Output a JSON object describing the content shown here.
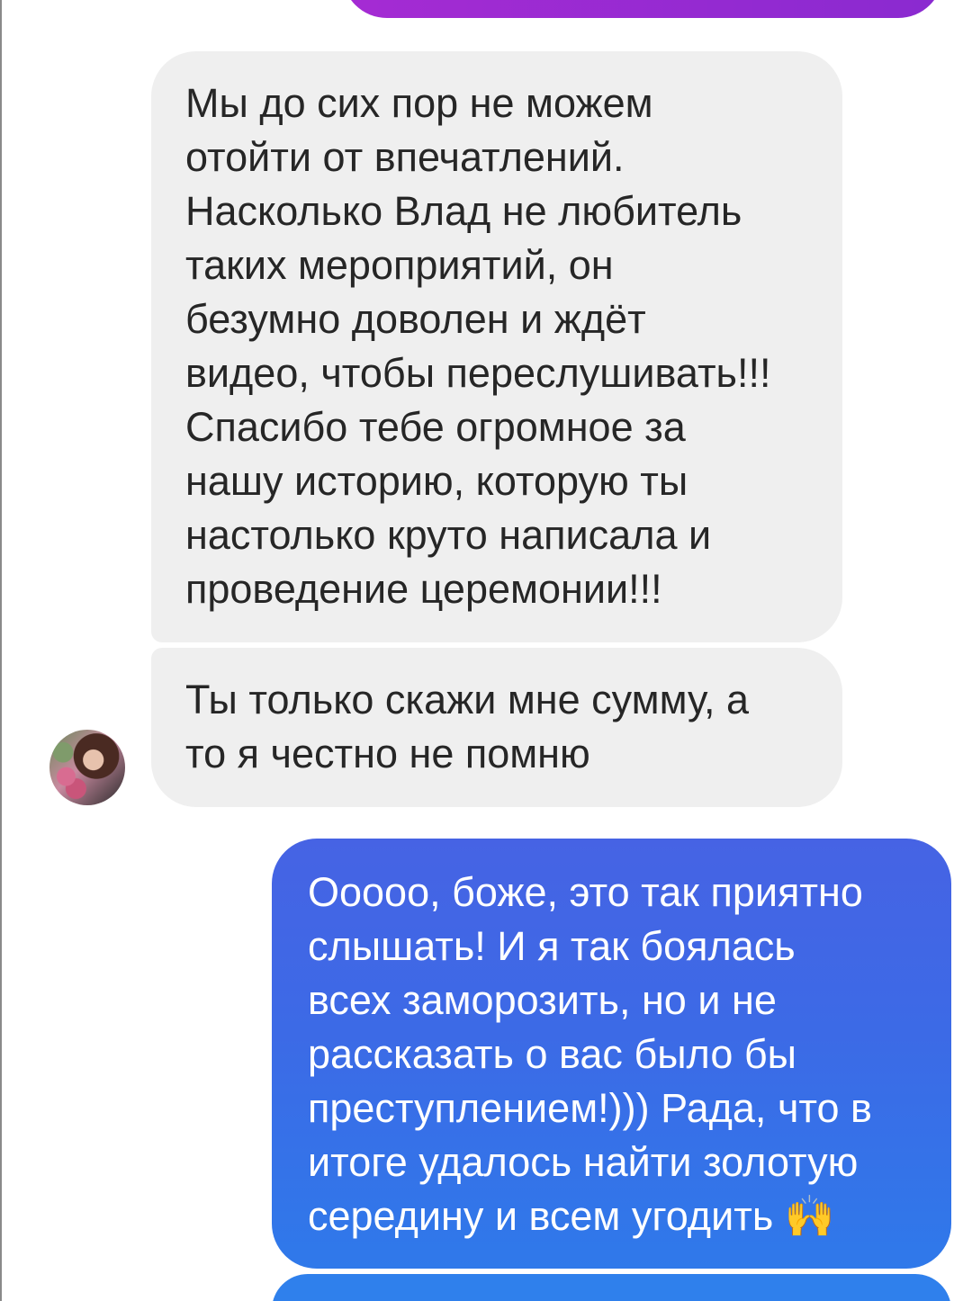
{
  "colors": {
    "incoming_bubble": "#efefef",
    "incoming_text": "#262626",
    "outgoing_top": "#4663e4",
    "outgoing_bottom": "#2f79ea",
    "previous_sent_bubble": "#9a2bd2"
  },
  "messages": [
    {
      "sender": "other",
      "text": "Мы до сих пор не можем\nотойти от впечатлений.\nНасколько Влад не любитель\nтаких мероприятий, он\nбезумно доволен и ждёт\nвидео, чтобы переслушивать!!!\nСпасибо тебе огромное за\nнашу историю, которую ты\nнастолько круто написала и\nпроведение церемонии!!!"
    },
    {
      "sender": "other",
      "text": "Ты только скажи мне сумму, а\nто я честно не помню"
    },
    {
      "sender": "me",
      "text": "Ооооо, боже, это так приятно\nслышать! И я так боялась\nвсех заморозить, но и не\nрассказать о вас было бы\nпреступлением!))) Рада, что в\nитоге удалось найти золотую\nсередину и всем угодить ",
      "emoji": "🙌",
      "emoji_name": "raising-hands-icon"
    }
  ],
  "avatar": {
    "icon": "contact-avatar"
  }
}
